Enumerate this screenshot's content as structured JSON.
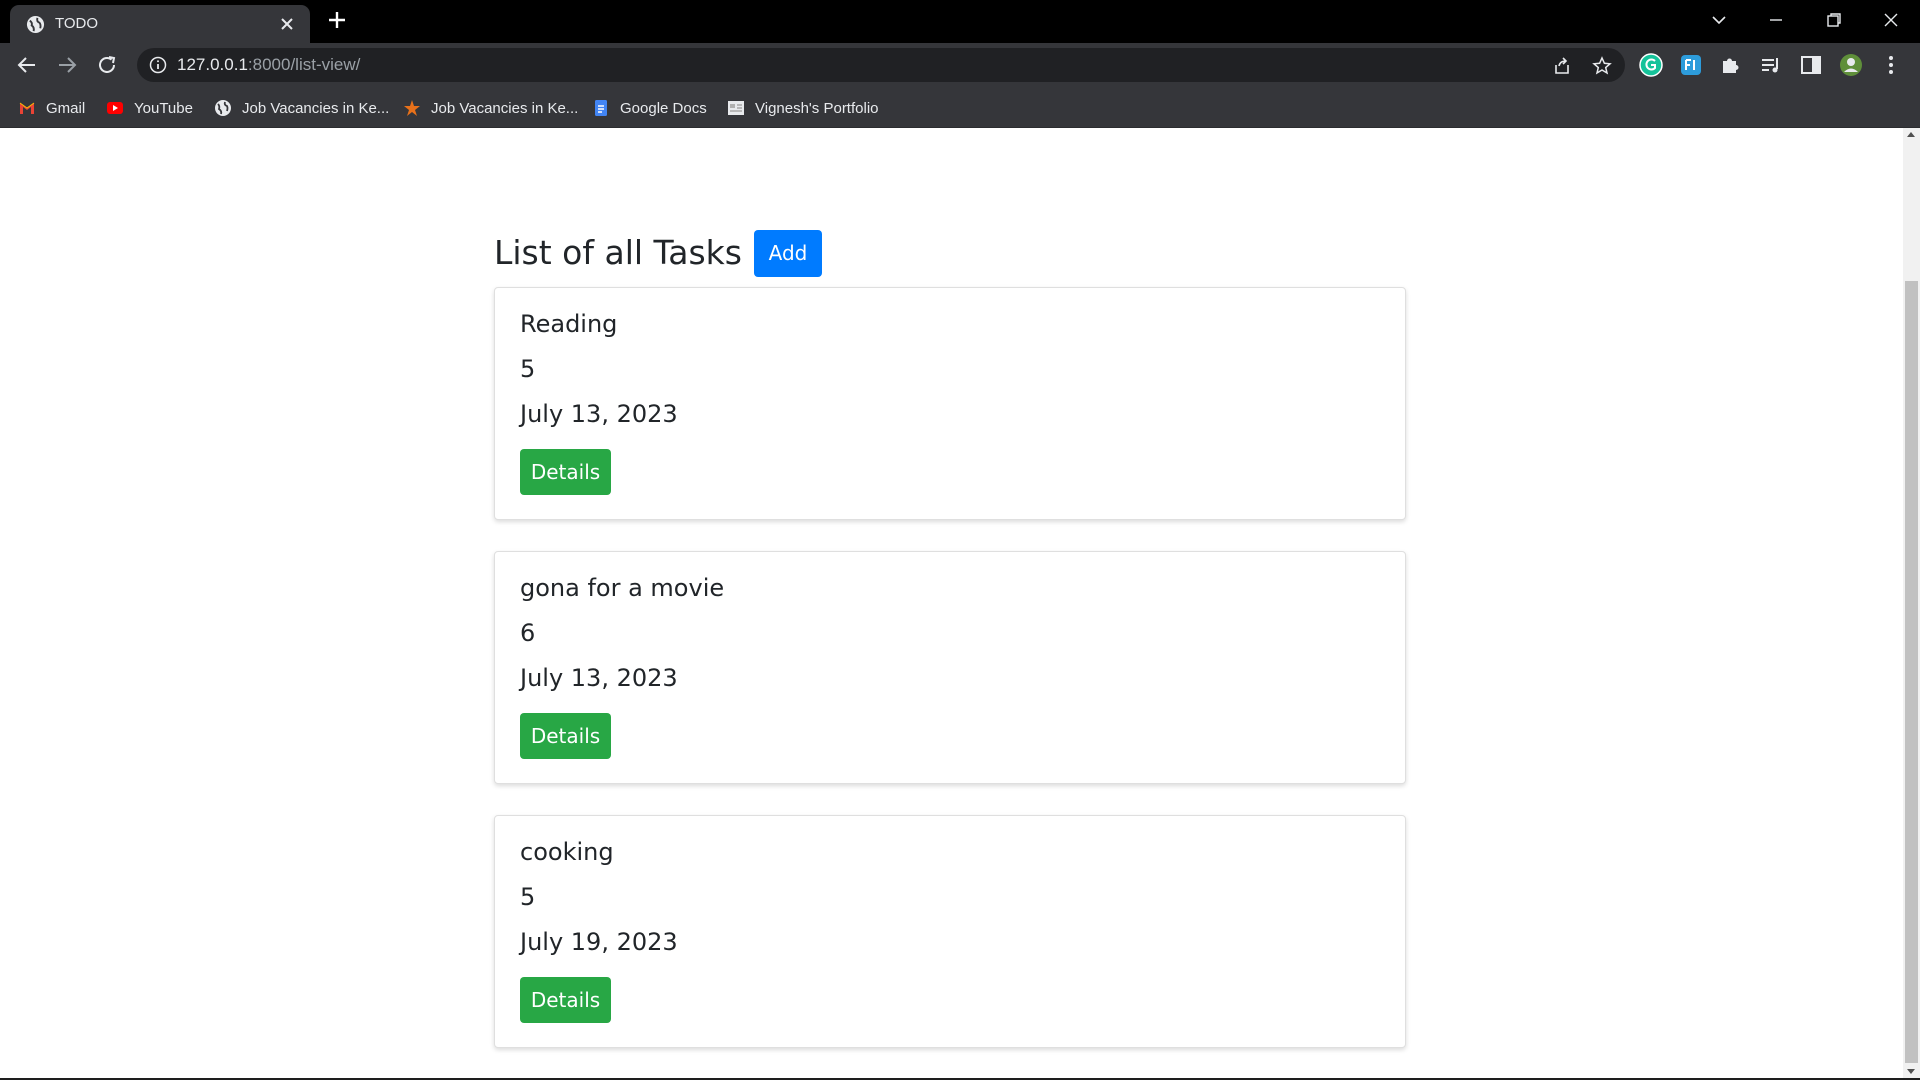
{
  "browser": {
    "tab_title": "TODO",
    "url_host": "127.0.0.1",
    "url_path": ":8000/list-view/",
    "icons": {
      "tab_favicon": "globe-icon",
      "tab_close": "close-icon",
      "new_tab": "plus-icon",
      "window": [
        "chevron-down-icon",
        "minimize-icon",
        "restore-icon",
        "close-icon"
      ],
      "nav": [
        "back-arrow-icon",
        "forward-arrow-icon",
        "reload-icon"
      ],
      "omnibox_right": [
        "share-icon",
        "star-icon"
      ],
      "extensions": [
        "grammarly-icon",
        "extension-fi-icon",
        "puzzle-icon",
        "media-queue-icon",
        "side-panel-icon",
        "profile-avatar-icon",
        "more-vert-icon"
      ]
    },
    "bookmarks": [
      {
        "label": "Gmail",
        "icon": "gmail-icon"
      },
      {
        "label": "YouTube",
        "icon": "youtube-icon"
      },
      {
        "label": "Job Vacancies in Ke...",
        "icon": "globe-icon"
      },
      {
        "label": "Job Vacancies in Ke...",
        "icon": "star-burst-icon"
      },
      {
        "label": "Google Docs",
        "icon": "docs-icon"
      },
      {
        "label": "Vignesh's Portfolio",
        "icon": "portfolio-icon"
      }
    ]
  },
  "page": {
    "title": "List of all Tasks",
    "add_label": "Add",
    "tasks": [
      {
        "name": "Reading",
        "number": "5",
        "date": "July 13, 2023",
        "details_label": "Details"
      },
      {
        "name": "gona for a movie",
        "number": "6",
        "date": "July 13, 2023",
        "details_label": "Details"
      },
      {
        "name": "cooking",
        "number": "5",
        "date": "July 19, 2023",
        "details_label": "Details"
      }
    ]
  },
  "colors": {
    "primary": "#007bff",
    "success": "#28a745",
    "text": "#212529",
    "chrome_dark": "#35363a",
    "tabstrip": "#000000"
  }
}
